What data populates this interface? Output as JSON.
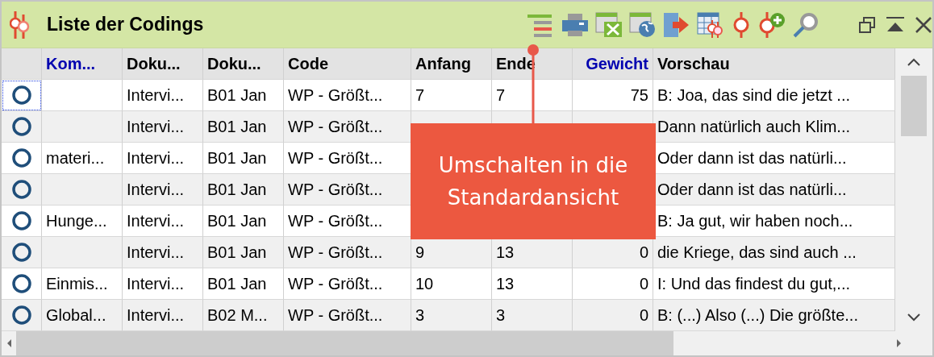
{
  "window": {
    "title": "Liste der Codings"
  },
  "toolbar": [
    {
      "kind": "lines",
      "selected": true
    },
    {
      "kind": "printer"
    },
    {
      "kind": "excel"
    },
    {
      "kind": "web"
    },
    {
      "kind": "export"
    },
    {
      "kind": "table-codings"
    },
    {
      "kind": "coding"
    },
    {
      "kind": "coding-add"
    },
    {
      "kind": "search"
    }
  ],
  "window_controls": [
    {
      "kind": "restore"
    },
    {
      "kind": "collapse"
    },
    {
      "kind": "close"
    }
  ],
  "table": {
    "columns": [
      {
        "label": "Kom...",
        "sortable": true
      },
      {
        "label": "Doku...",
        "sortable": false
      },
      {
        "label": "Doku...",
        "sortable": false
      },
      {
        "label": "Code",
        "sortable": false
      },
      {
        "label": "Anfang",
        "sortable": false
      },
      {
        "label": "Ende",
        "sortable": false
      },
      {
        "label": "Gewicht",
        "sortable": true
      },
      {
        "label": "Vorschau",
        "sortable": false
      }
    ],
    "rows": [
      {
        "focused": true,
        "cells": [
          null,
          "Intervi...",
          "B01 Jan",
          "WP - Größt...",
          "7",
          "7",
          "75",
          "B: Joa, das sind die jetzt ..."
        ]
      },
      {
        "focused": false,
        "cells": [
          null,
          "Intervi...",
          "B01 Jan",
          "WP - Größt...",
          null,
          null,
          null,
          "Dann natürlich auch Klim..."
        ]
      },
      {
        "focused": false,
        "cells": [
          "materi...",
          "Intervi...",
          "B01 Jan",
          "WP - Größt...",
          null,
          null,
          null,
          "Oder dann ist das natürli..."
        ]
      },
      {
        "focused": false,
        "cells": [
          null,
          "Intervi...",
          "B01 Jan",
          "WP - Größt...",
          null,
          null,
          null,
          "Oder dann ist das natürli..."
        ]
      },
      {
        "focused": false,
        "cells": [
          "Hunge...",
          "Intervi...",
          "B01 Jan",
          "WP - Größt...",
          null,
          null,
          null,
          "B: Ja gut, wir haben noch..."
        ]
      },
      {
        "focused": false,
        "cells": [
          null,
          "Intervi...",
          "B01 Jan",
          "WP - Größt...",
          "9",
          "13",
          "0",
          "die Kriege, das sind auch ..."
        ]
      },
      {
        "focused": false,
        "cells": [
          "Einmis...",
          "Intervi...",
          "B01 Jan",
          "WP - Größt...",
          "10",
          "13",
          "0",
          "I: Und das findest du gut,..."
        ]
      },
      {
        "focused": false,
        "cells": [
          "Global...",
          "Intervi...",
          "B02 M...",
          "WP - Größt...",
          "3",
          "3",
          "0",
          "B: (...) Also (...) Die größte..."
        ]
      }
    ]
  },
  "callout": {
    "text": "Umschalten in die Standardansicht"
  }
}
